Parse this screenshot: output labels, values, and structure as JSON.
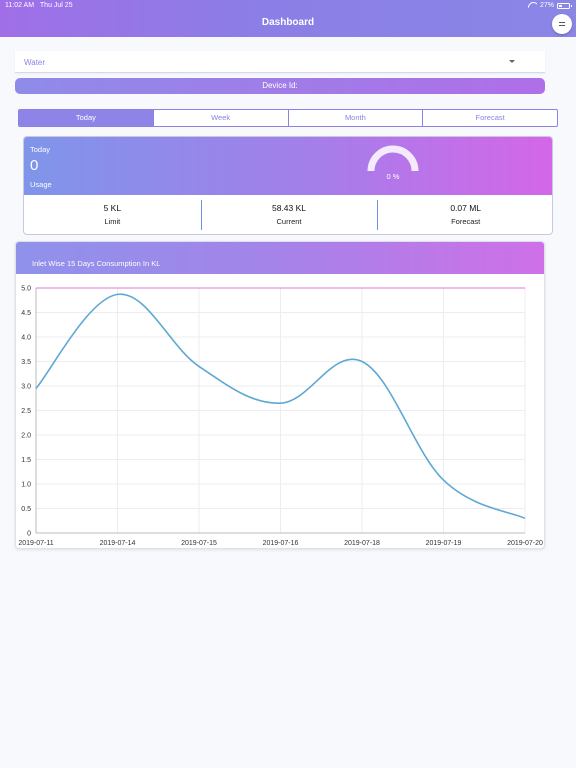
{
  "status_bar": {
    "time": "11:02 AM",
    "date": "Thu Jul 25",
    "battery": "27%"
  },
  "header": {
    "title": "Dashboard"
  },
  "selector": {
    "value": "Water"
  },
  "device": {
    "label": "Device Id:"
  },
  "tabs": [
    {
      "label": "Today",
      "active": true
    },
    {
      "label": "Week",
      "active": false
    },
    {
      "label": "Month",
      "active": false
    },
    {
      "label": "Forecast",
      "active": false
    }
  ],
  "today": {
    "label": "Today",
    "value": "0",
    "usage_label": "Usage",
    "gauge_percent": "0 %",
    "stats": [
      {
        "value": "5 KL",
        "label": "Limit"
      },
      {
        "value": "58.43 KL",
        "label": "Current"
      },
      {
        "value": "0.07 ML",
        "label": "Forecast"
      }
    ]
  },
  "chart": {
    "title": "Inlet Wise 15 Days Consumption In KL"
  },
  "colors": {
    "line": "#5fa8d3",
    "limit_line": "#e07bd0",
    "accent": "#8a82e6"
  },
  "chart_data": {
    "type": "line",
    "title": "",
    "xlabel": "",
    "ylabel": "",
    "x": [
      "2019-07-11",
      "2019-07-14",
      "2019-07-15",
      "2019-07-16",
      "2019-07-18",
      "2019-07-19",
      "2019-07-20"
    ],
    "series": [
      {
        "values": [
          2.95,
          4.87,
          3.4,
          2.65,
          3.5,
          1.08,
          0.3
        ]
      }
    ],
    "reference_line": 5.0,
    "ylim": [
      0,
      5
    ],
    "yticks": [
      0,
      0.5,
      1.0,
      1.5,
      2.0,
      2.5,
      3.0,
      3.5,
      4.0,
      4.5,
      5.0
    ],
    "ytick_labels": [
      "0",
      "0.5",
      "1.0",
      "1.5",
      "2.0",
      "2.5",
      "3.0",
      "3.5",
      "4.0",
      "4.5",
      "5.0"
    ],
    "grid": true
  }
}
